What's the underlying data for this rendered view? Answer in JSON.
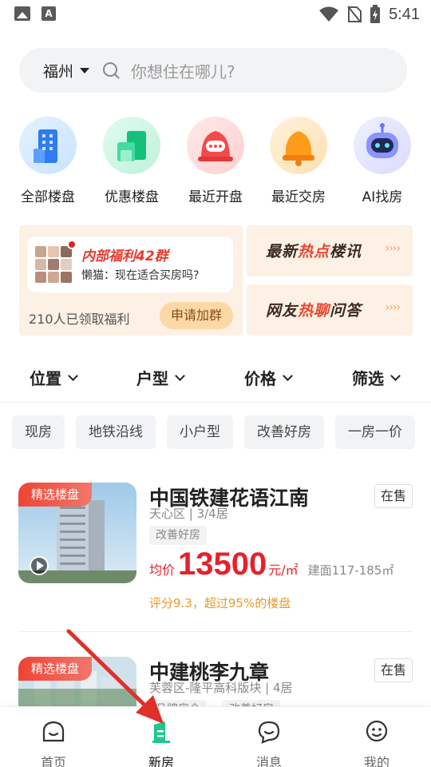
{
  "status_bar": {
    "time": "5:41"
  },
  "search": {
    "city": "福州",
    "placeholder": "你想住在哪儿?"
  },
  "categories": [
    {
      "label": "全部楼盘",
      "icon": "building-icon"
    },
    {
      "label": "优惠楼盘",
      "icon": "discount-building-icon"
    },
    {
      "label": "最近开盘",
      "icon": "bell-chat-icon"
    },
    {
      "label": "最近交房",
      "icon": "bell-icon"
    },
    {
      "label": "AI找房",
      "icon": "robot-icon"
    }
  ],
  "banner": {
    "group_title": "内部福利42群",
    "group_message": "懒猫：现在适合买房吗?",
    "claimed_count": "210人已领取福利",
    "join_button": "申请加群",
    "hot_news": {
      "pre": "最新",
      "hl": "热点",
      "post": "楼讯"
    },
    "qa": {
      "pre": "网友",
      "hl": "热聊",
      "post": "问答"
    },
    "arrows": "››››"
  },
  "filters": [
    "位置",
    "户型",
    "价格",
    "筛选"
  ],
  "tags": [
    "现房",
    "地铁沿线",
    "小户型",
    "改善好房",
    "一房一价"
  ],
  "listings": [
    {
      "badge": "精选楼盘",
      "name": "中国铁建花语江南",
      "status": "在售",
      "district": "天心区 | 3/4居",
      "features": [
        "改善好房"
      ],
      "price_prefix": "均价",
      "price": "13500",
      "price_unit": "元/㎡",
      "area": "建面117-185㎡",
      "rating": "评分9.3，超过95%的楼盘"
    },
    {
      "badge": "精选楼盘",
      "name": "中建桃李九章",
      "status": "在售",
      "district": "芙蓉区-隆平高科版块 | 4居",
      "features": [
        "品牌房企",
        "改善好房"
      ]
    }
  ],
  "bottom_nav": [
    {
      "label": "首页",
      "icon": "home-face-icon"
    },
    {
      "label": "新房",
      "icon": "new-house-icon",
      "active": true
    },
    {
      "label": "消息",
      "icon": "message-icon"
    },
    {
      "label": "我的",
      "icon": "profile-icon"
    }
  ],
  "colors": {
    "accent_green": "#1fc88a",
    "price_red": "#e8202a",
    "rating_orange": "#e89a2e"
  }
}
